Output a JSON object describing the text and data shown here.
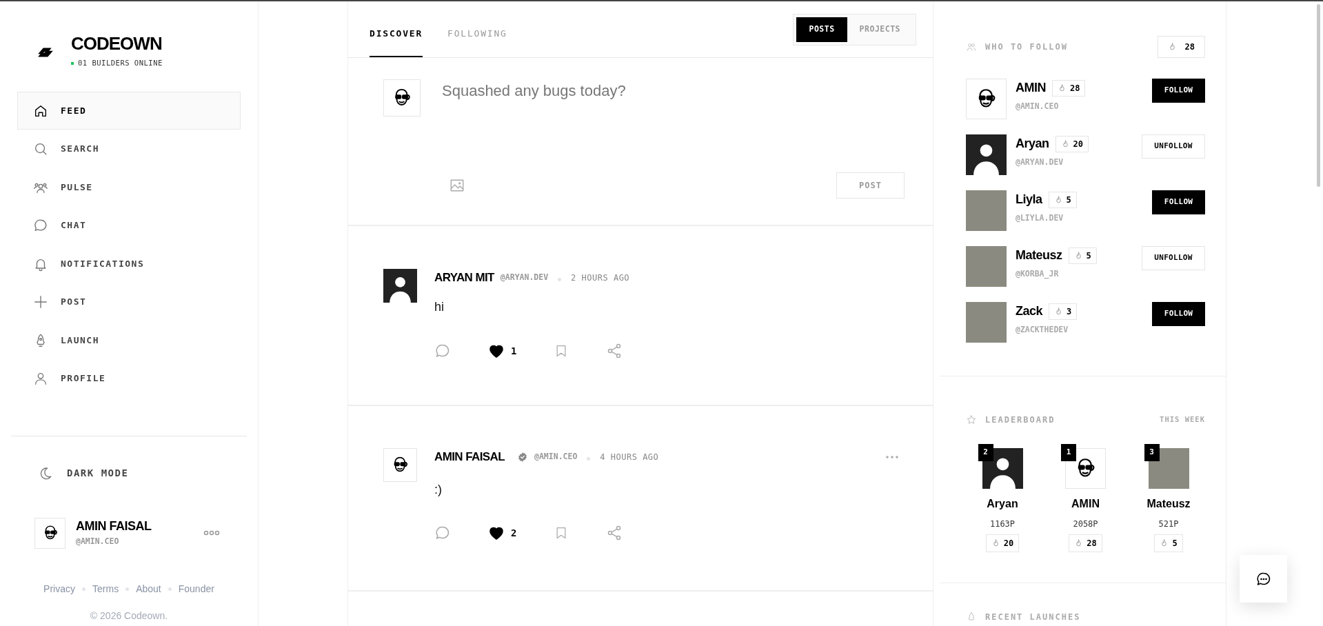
{
  "brand": {
    "name": "CODEOWN",
    "online": "01 BUILDERS ONLINE"
  },
  "nav": [
    {
      "label": "FEED",
      "selected": true
    },
    {
      "label": "SEARCH",
      "selected": false
    },
    {
      "label": "PULSE",
      "selected": false
    },
    {
      "label": "CHAT",
      "selected": false
    },
    {
      "label": "NOTIFICATIONS",
      "selected": false
    },
    {
      "label": "POST",
      "selected": false
    },
    {
      "label": "LAUNCH",
      "selected": false
    },
    {
      "label": "PROFILE",
      "selected": false
    }
  ],
  "dark_mode": {
    "label": "DARK MODE"
  },
  "current_user": {
    "name": "AMIN FAISAL",
    "handle": "@AMIN.CEO",
    "avatar": {
      "kind": "cartoon"
    }
  },
  "footer": {
    "links": [
      "Privacy",
      "Terms",
      "About",
      "Founder"
    ],
    "copyright": "© 2026 Codeown."
  },
  "feed_tabs": [
    {
      "label": "DISCOVER",
      "selected": true
    },
    {
      "label": "FOLLOWING",
      "selected": false
    }
  ],
  "view_toggle": [
    {
      "label": "POSTS",
      "selected": true
    },
    {
      "label": "PROJECTS",
      "selected": false
    }
  ],
  "composer": {
    "avatar": {
      "kind": "cartoon"
    },
    "placeholder": "Squashed any bugs today?",
    "post_button": "POST"
  },
  "posts": [
    {
      "author": "ARYAN MIT",
      "verified": false,
      "handle": "@ARYAN.DEV",
      "time": "2 HOURS AGO",
      "text": "hi",
      "likes": "1",
      "liked": true,
      "has_menu": false,
      "avatar": {
        "kind": "silhouette"
      }
    },
    {
      "author": "AMIN FAISAL",
      "verified": true,
      "handle": "@AMIN.CEO",
      "time": "4 HOURS AGO",
      "text": ":)",
      "likes": "2",
      "liked": true,
      "has_menu": true,
      "avatar": {
        "kind": "cartoon"
      }
    }
  ],
  "who_to_follow": {
    "title": "WHO TO FOLLOW",
    "streak": "28",
    "users": [
      {
        "name": "AMIN",
        "streak": "28",
        "handle": "@AMIN.CEO",
        "avatar": {
          "kind": "cartoon"
        },
        "following": false,
        "button": "FOLLOW"
      },
      {
        "name": "Aryan",
        "streak": "20",
        "handle": "@ARYAN.DEV",
        "avatar": {
          "kind": "silhouette"
        },
        "following": true,
        "button": "UNFOLLOW"
      },
      {
        "name": "Liyla",
        "streak": "5",
        "handle": "@LIYLA.DEV",
        "avatar": {
          "kind": "photo"
        },
        "following": false,
        "button": "FOLLOW"
      },
      {
        "name": "Mateusz",
        "streak": "5",
        "handle": "@KORBA_JR",
        "avatar": {
          "kind": "photo"
        },
        "following": true,
        "button": "UNFOLLOW"
      },
      {
        "name": "Zack",
        "streak": "3",
        "handle": "@ZACKTHEDEV",
        "avatar": {
          "kind": "photo"
        },
        "following": false,
        "button": "FOLLOW"
      }
    ]
  },
  "leaderboard": {
    "title": "LEADERBOARD",
    "period": "THIS WEEK",
    "entries": [
      {
        "rank": "2",
        "name": "Aryan",
        "points": "1163P",
        "streak": "20",
        "avatar": {
          "kind": "silhouette"
        }
      },
      {
        "rank": "1",
        "name": "AMIN",
        "points": "2058P",
        "streak": "28",
        "avatar": {
          "kind": "cartoon"
        }
      },
      {
        "rank": "3",
        "name": "Mateusz",
        "points": "521P",
        "streak": "5",
        "avatar": {
          "kind": "photo"
        }
      }
    ]
  },
  "recent_launches": {
    "title": "RECENT LAUNCHES"
  }
}
